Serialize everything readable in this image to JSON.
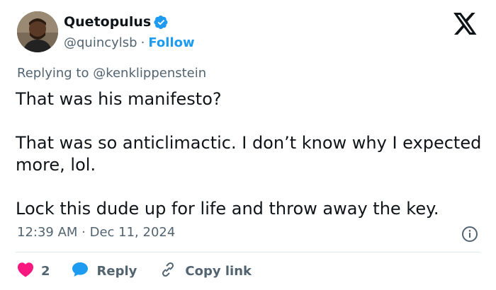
{
  "author": {
    "name": "Quetopulus",
    "handle": "@quincylsb",
    "separator": "·",
    "follow_label": "Follow"
  },
  "reply": {
    "prefix": "Replying to ",
    "mention": "@kenklippenstein"
  },
  "tweet": {
    "paragraphs": [
      "That was his manifesto?",
      "That was so anticlimactic. I don’t know why I expected more, lol.",
      "Lock this dude up for life and throw away the key."
    ]
  },
  "timestamp": "12:39 AM · Dec 11, 2024",
  "actions": {
    "likes_count": "2",
    "reply_label": "Reply",
    "copy_link_label": "Copy link"
  },
  "colors": {
    "text": "#0f1419",
    "secondary": "#536471",
    "accent": "#1d9bf0",
    "like": "#f91880"
  },
  "icons": {
    "verified": "verified-badge-icon",
    "platform": "x-logo-icon",
    "info": "info-icon",
    "like": "heart-icon",
    "reply": "speech-bubble-icon",
    "copy": "link-icon"
  }
}
